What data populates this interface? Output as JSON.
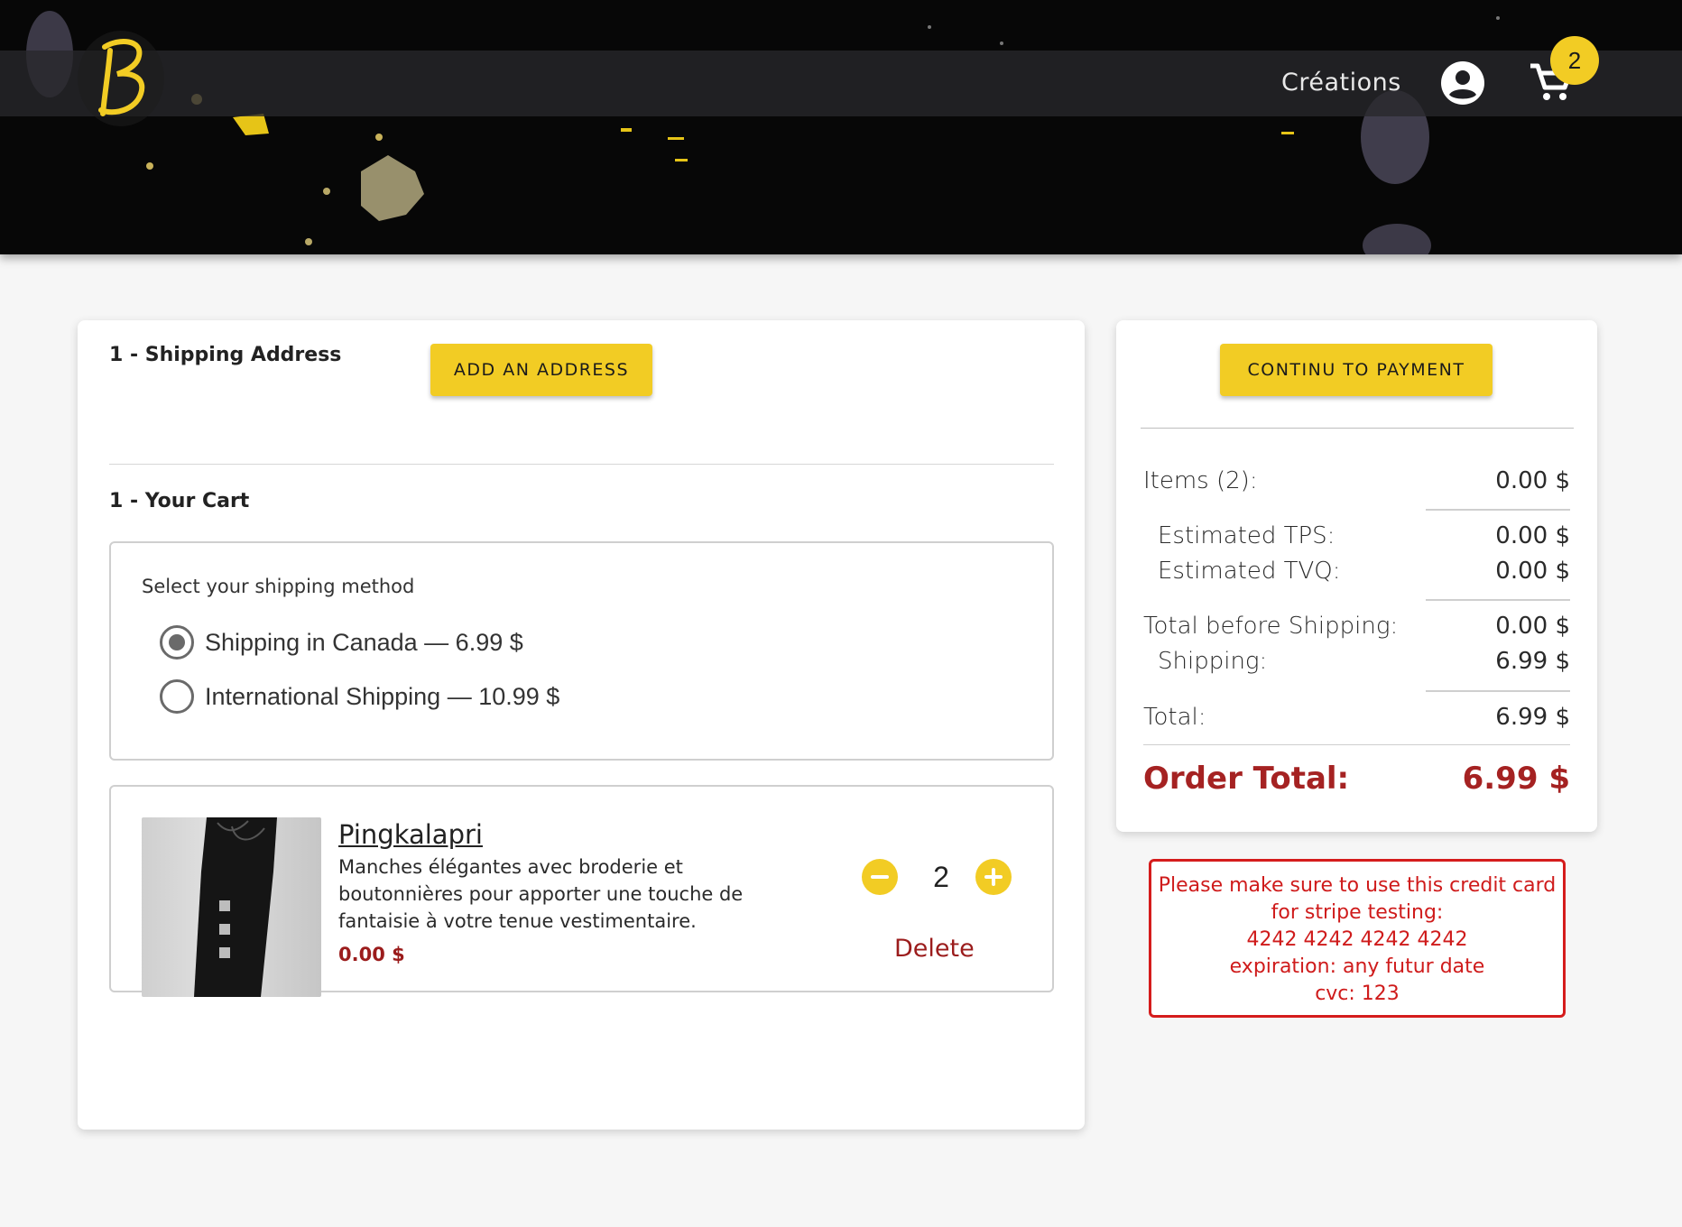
{
  "header": {
    "nav_link": "Créations",
    "cart_count": "2",
    "icons": {
      "logo": "b-logo",
      "account": "account-circle-icon",
      "cart": "shopping-cart-icon"
    }
  },
  "shipping_address": {
    "title": "1 - Shipping Address",
    "add_button": "ADD AN ADDRESS"
  },
  "cart": {
    "title": "1 - Your Cart",
    "shipping_method": {
      "label": "Select your shipping method",
      "options": [
        {
          "label": "Shipping in Canada — 6.99 $",
          "selected": true
        },
        {
          "label": "International Shipping — 10.99 $",
          "selected": false
        }
      ]
    },
    "items": [
      {
        "name": "Pingkalapri",
        "description": "Manches élégantes avec broderie et boutonnières pour apporter une touche de fantaisie à votre tenue vestimentaire.",
        "price": "0.00 $",
        "quantity": "2",
        "delete_label": "Delete"
      }
    ]
  },
  "summary": {
    "continue_button": "CONTINU TO PAYMENT",
    "items_label": "Items (2):",
    "items_value": "0.00 $",
    "tps_label": "Estimated TPS:",
    "tps_value": "0.00 $",
    "tvq_label": "Estimated TVQ:",
    "tvq_value": "0.00 $",
    "before_shipping_label": "Total before Shipping:",
    "before_shipping_value": "0.00 $",
    "shipping_label": "Shipping:",
    "shipping_value": "6.99 $",
    "total_label": "Total:",
    "total_value": "6.99 $",
    "order_total_label": "Order Total:",
    "order_total_value": "6.99 $"
  },
  "notice": {
    "lines": [
      "Please make sure to use this credit card",
      "for stripe testing:",
      "4242 4242 4242 4242",
      "expiration: any futur date",
      "cvc: 123"
    ]
  },
  "colors": {
    "accent_yellow": "#f2cc24",
    "price_red": "#9b1c1c",
    "notice_red": "#d51c1c",
    "background": "#f6f6f6"
  }
}
